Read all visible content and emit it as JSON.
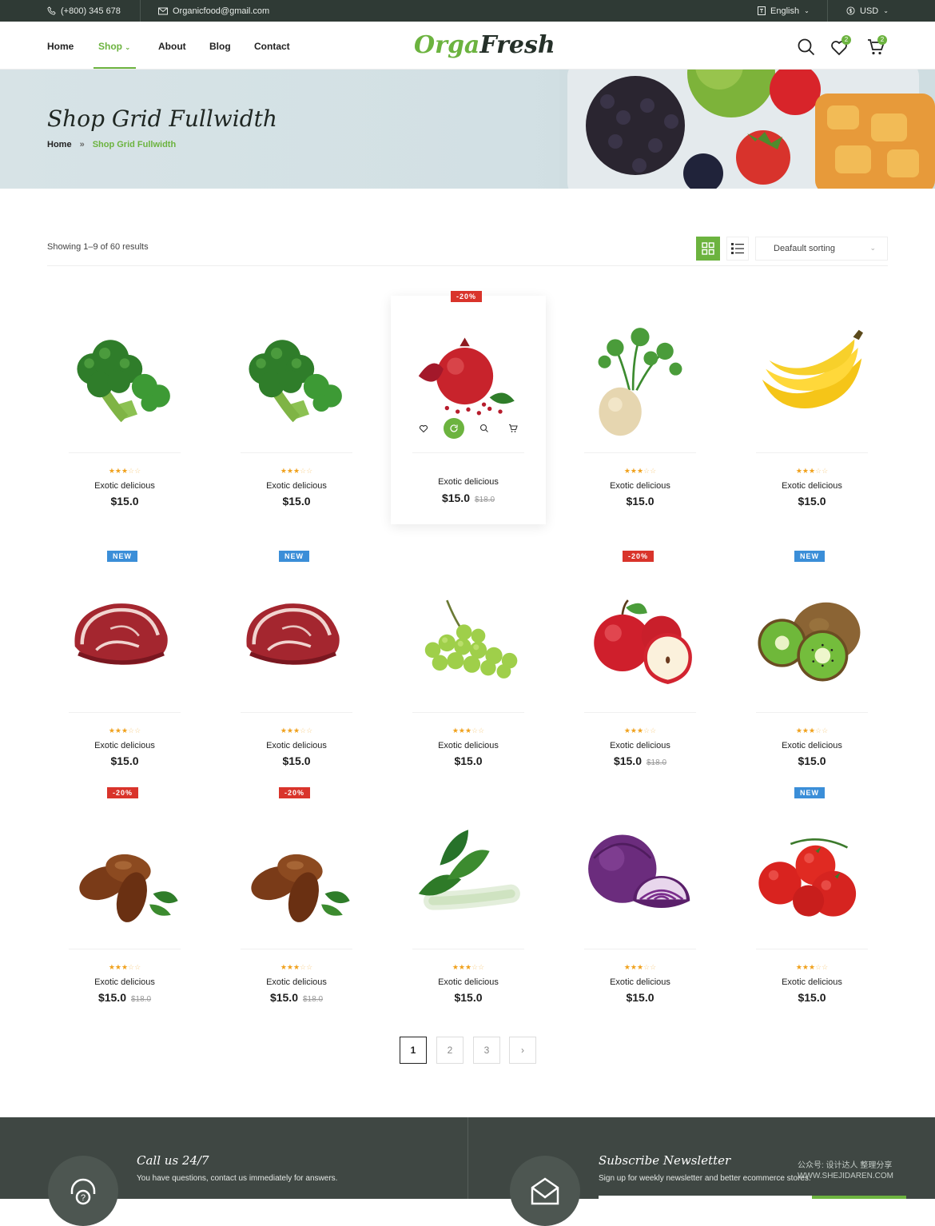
{
  "topbar": {
    "phone": "(+800) 345 678",
    "email": "Organicfood@gmail.com",
    "language": "English",
    "currency": "USD"
  },
  "nav": {
    "items": [
      "Home",
      "Shop",
      "About",
      "Blog",
      "Contact"
    ],
    "active": "Shop"
  },
  "logo": {
    "part1": "Orga",
    "part2": "Fresh"
  },
  "header_icons": {
    "wishlist_count": "2",
    "cart_count": "2"
  },
  "hero": {
    "title": "Shop Grid Fullwidth",
    "breadcrumb_home": "Home",
    "breadcrumb_sep": "»",
    "breadcrumb_current": "Shop Grid Fullwidth"
  },
  "toolbar": {
    "results_text": "Showing 1–9 of 60 results",
    "sort_label": "Deafault sorting"
  },
  "products": [
    {
      "name": "Exotic delicious",
      "price": "$15.0",
      "old_price": "",
      "tag": "",
      "image": "broccoli",
      "rating": 3
    },
    {
      "name": "Exotic delicious",
      "price": "$15.0",
      "old_price": "",
      "tag": "",
      "image": "broccoli",
      "rating": 3
    },
    {
      "name": "Exotic delicious",
      "price": "$15.0",
      "old_price": "$18.0",
      "tag": "-20%",
      "image": "pomegranate",
      "rating": 3,
      "featured": true
    },
    {
      "name": "Exotic delicious",
      "price": "$15.0",
      "old_price": "",
      "tag": "",
      "image": "celeriac",
      "rating": 3
    },
    {
      "name": "Exotic delicious",
      "price": "$15.0",
      "old_price": "",
      "tag": "",
      "image": "banana",
      "rating": 3
    },
    {
      "name": "Exotic delicious",
      "price": "$15.0",
      "old_price": "",
      "tag": "NEW",
      "image": "meat",
      "rating": 3
    },
    {
      "name": "Exotic delicious",
      "price": "$15.0",
      "old_price": "",
      "tag": "NEW",
      "image": "meat",
      "rating": 3
    },
    {
      "name": "Exotic delicious",
      "price": "$15.0",
      "old_price": "",
      "tag": "",
      "image": "grapes",
      "rating": 3
    },
    {
      "name": "Exotic delicious",
      "price": "$15.0",
      "old_price": "$18.0",
      "tag": "-20%",
      "image": "apple",
      "rating": 3
    },
    {
      "name": "Exotic delicious",
      "price": "$15.0",
      "old_price": "",
      "tag": "NEW",
      "image": "kiwi",
      "rating": 3
    },
    {
      "name": "Exotic delicious",
      "price": "$15.0",
      "old_price": "$18.0",
      "tag": "-20%",
      "image": "dates",
      "rating": 3
    },
    {
      "name": "Exotic delicious",
      "price": "$15.0",
      "old_price": "$18.0",
      "tag": "-20%",
      "image": "dates",
      "rating": 3
    },
    {
      "name": "Exotic delicious",
      "price": "$15.0",
      "old_price": "",
      "tag": "",
      "image": "bok-choy",
      "rating": 3
    },
    {
      "name": "Exotic delicious",
      "price": "$15.0",
      "old_price": "",
      "tag": "",
      "image": "red-cabbage",
      "rating": 3
    },
    {
      "name": "Exotic delicious",
      "price": "$15.0",
      "old_price": "",
      "tag": "NEW",
      "image": "tomato",
      "rating": 3
    }
  ],
  "pagination": {
    "pages": [
      "1",
      "2",
      "3"
    ],
    "current": "1",
    "next": "›"
  },
  "footer": {
    "call_title": "Call us 24/7",
    "call_text": "You have questions, contact us immediately for answers.",
    "newsletter_title": "Subscribe Newsletter",
    "newsletter_text": "Sign up for weekly newsletter and better ecommerce stores."
  },
  "watermark": "公众号: 设计达人 整理分享 WWW.SHEJIDAREN.COM",
  "colors": {
    "accent": "#6cb33f",
    "topbar": "#2f3a35",
    "sale": "#d9342b",
    "new": "#3b8ed8",
    "footer": "#3f4743"
  }
}
